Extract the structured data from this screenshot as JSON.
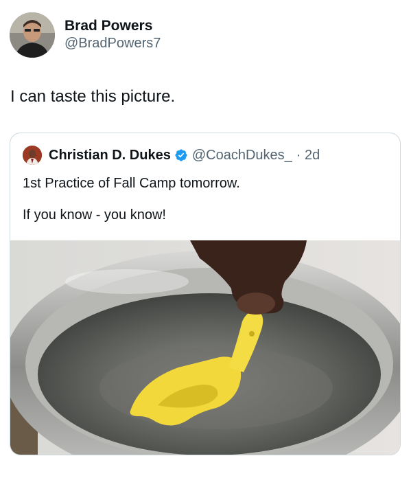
{
  "author": {
    "display_name": "Brad Powers",
    "handle": "@BradPowers7"
  },
  "tweet_text": "I can taste this picture.",
  "quoted": {
    "display_name": "Christian D. Dukes",
    "handle": "@CoachDukes_",
    "time": "· 2d",
    "line1": "1st Practice of Fall Camp tomorrow.",
    "line2": "If you know - you know!"
  },
  "colors": {
    "text": "#0f1419",
    "secondary": "#536471",
    "verified": "#1d9bf0",
    "border": "#cfd9de",
    "mouthguard": "#f2d83a"
  }
}
